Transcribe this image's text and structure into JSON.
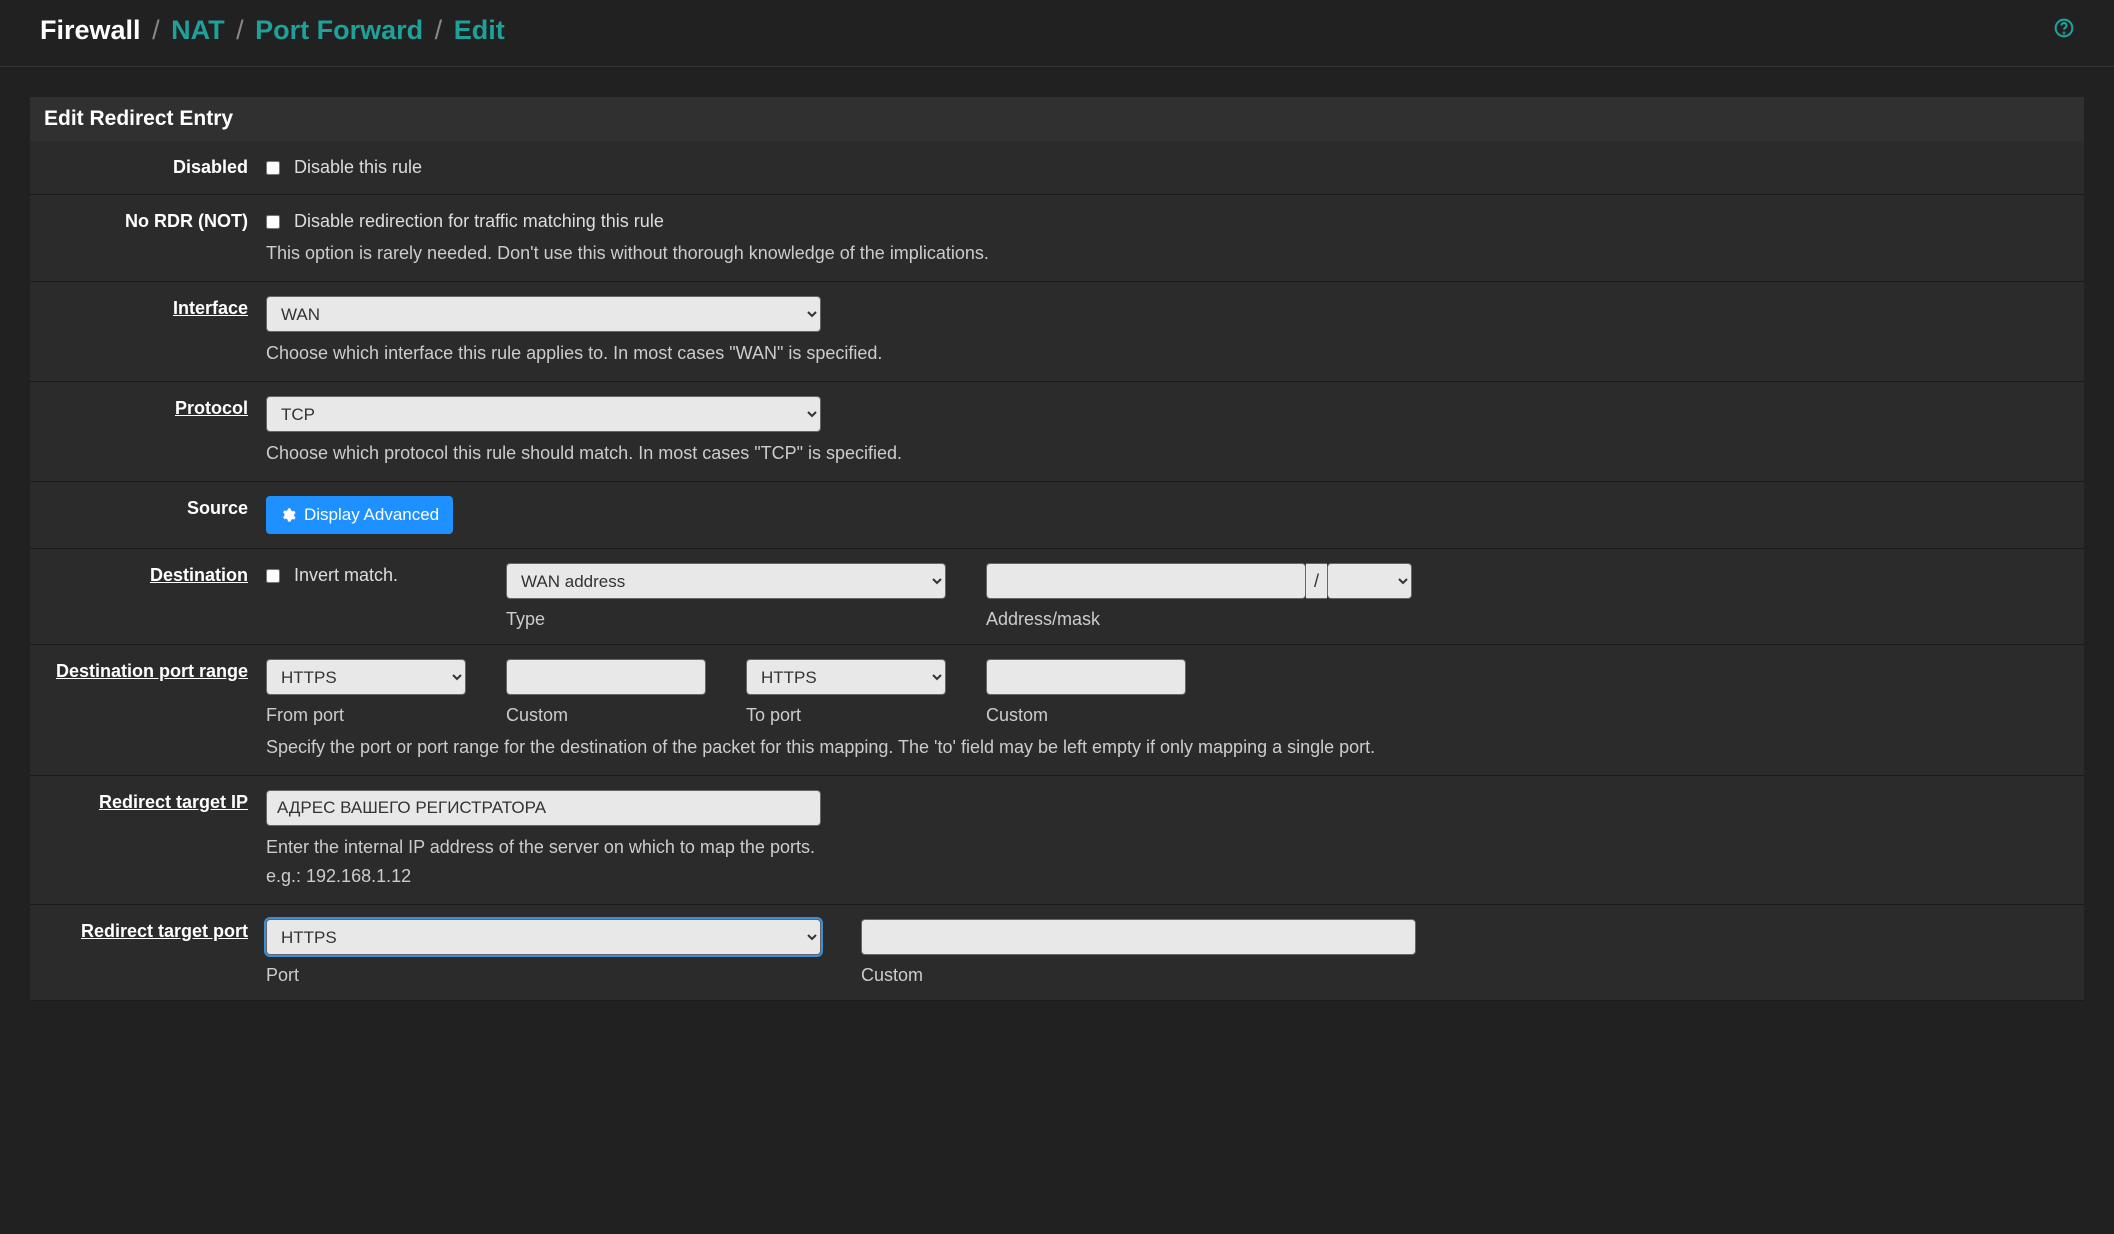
{
  "breadcrumb": {
    "firewall": "Firewall",
    "nat": "NAT",
    "port_forward": "Port Forward",
    "edit": "Edit"
  },
  "panel_title": "Edit Redirect Entry",
  "rows": {
    "disabled": {
      "label": "Disabled",
      "checkbox_label": "Disable this rule"
    },
    "no_rdr": {
      "label": "No RDR (NOT)",
      "checkbox_label": "Disable redirection for traffic matching this rule",
      "help": "This option is rarely needed. Don't use this without thorough knowledge of the implications."
    },
    "interface": {
      "label": "Interface",
      "value": "WAN",
      "help": "Choose which interface this rule applies to. In most cases \"WAN\" is specified."
    },
    "protocol": {
      "label": "Protocol",
      "value": "TCP",
      "help": "Choose which protocol this rule should match. In most cases \"TCP\" is specified."
    },
    "source": {
      "label": "Source",
      "button": "Display Advanced"
    },
    "destination": {
      "label": "Destination",
      "invert_label": "Invert match.",
      "type_value": "WAN address",
      "type_caption": "Type",
      "slash": "/",
      "addr_caption": "Address/mask"
    },
    "dst_port": {
      "label": "Destination port range",
      "from_value": "HTTPS",
      "from_caption": "From port",
      "custom_from_caption": "Custom",
      "to_value": "HTTPS",
      "to_caption": "To port",
      "custom_to_caption": "Custom",
      "help": "Specify the port or port range for the destination of the packet for this mapping. The 'to' field may be left empty if only mapping a single port."
    },
    "redirect_ip": {
      "label": "Redirect target IP",
      "value": "АДРЕС ВАШЕГО РЕГИСТРАТОРА",
      "help1": "Enter the internal IP address of the server on which to map the ports.",
      "help2": "e.g.: 192.168.1.12"
    },
    "redirect_port": {
      "label": "Redirect target port",
      "value": "HTTPS",
      "port_caption": "Port",
      "custom_caption": "Custom"
    }
  }
}
